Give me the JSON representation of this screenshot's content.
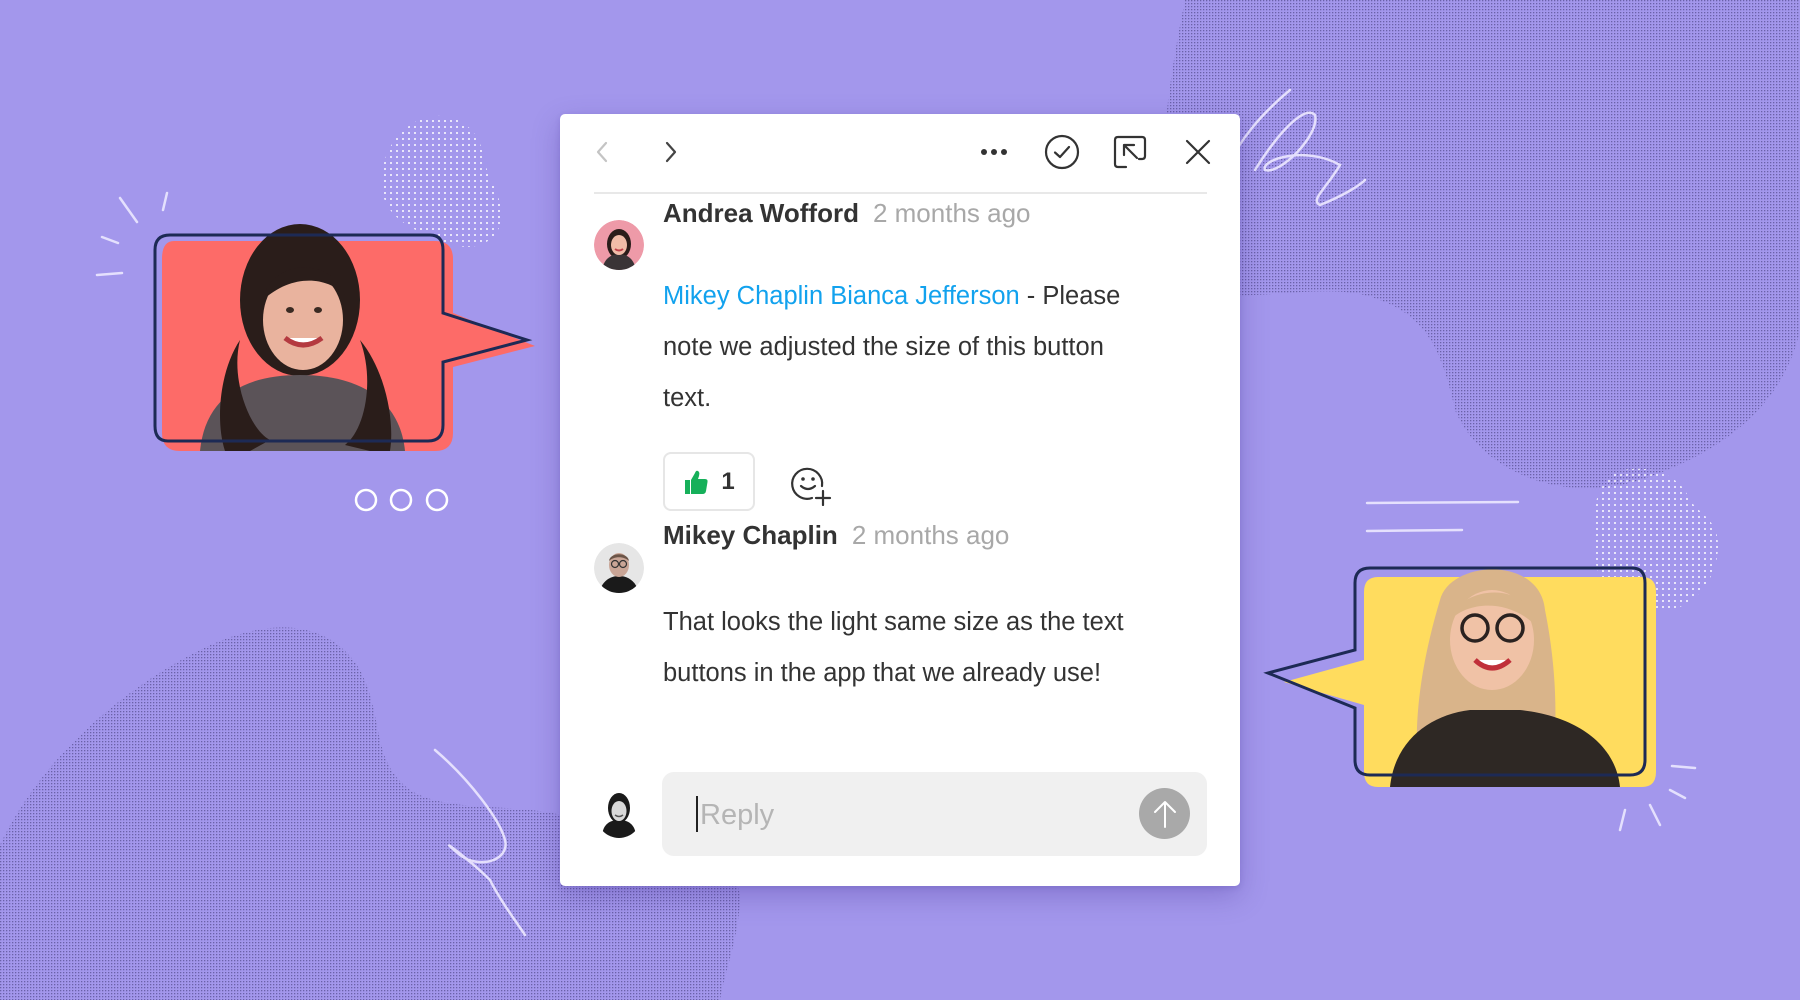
{
  "header": {
    "prev_icon": "chevron-left-icon",
    "next_icon": "chevron-right-icon",
    "more_icon": "more-horizontal-icon",
    "resolve_icon": "check-circle-icon",
    "popout_icon": "arrow-up-left-box-icon",
    "close_icon": "close-icon"
  },
  "comments": [
    {
      "author": "Andrea Wofford",
      "time": "2 months ago",
      "mentions": "Mikey Chaplin Bianca Jefferson",
      "text": " - Please note we adjusted the size of this button text.",
      "reactions": [
        {
          "icon": "thumbs-up-icon",
          "count": "1",
          "color": "#16b05a"
        }
      ],
      "add_reaction_icon": "emoji-add-icon"
    },
    {
      "author": "Mikey Chaplin",
      "time": "2 months ago",
      "text": "That looks the light same size as the text buttons in the app that we already use!"
    }
  ],
  "reply": {
    "placeholder": "Reply",
    "value": "",
    "send_icon": "arrow-up-icon"
  },
  "colors": {
    "background": "#a397ec",
    "mention": "#12a2ee",
    "card_left": "#fd6b68",
    "card_right": "#ffdc5e",
    "outline": "#1d2a55"
  }
}
